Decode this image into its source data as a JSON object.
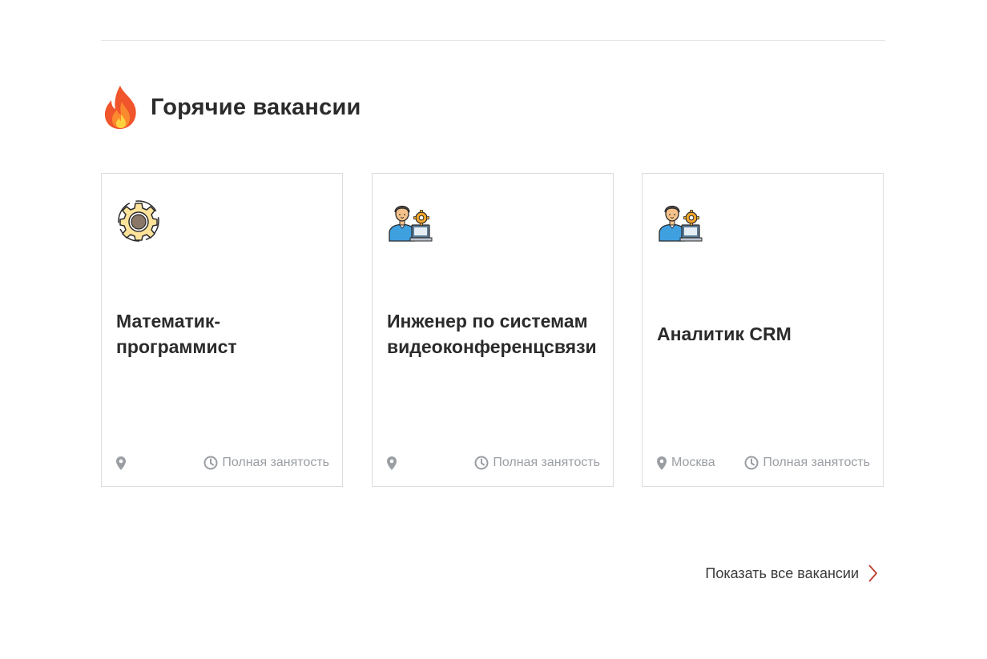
{
  "section": {
    "title": "Горячие вакансии",
    "icon": "fire-icon"
  },
  "vacancies": [
    {
      "title": "Математик-программист",
      "icon": "gear-icon",
      "location": "",
      "employment": "Полная занятость"
    },
    {
      "title": "Инженер по системам видеоконференцсвязи",
      "icon": "engineer-icon",
      "location": "",
      "employment": "Полная занятость"
    },
    {
      "title": "Аналитик CRM",
      "icon": "engineer-icon",
      "location": "Москва",
      "employment": "Полная занятость"
    }
  ],
  "show_all": {
    "label": "Показать все вакансии",
    "icon": "chevron-right-icon"
  },
  "colors": {
    "accent": "#c0392b",
    "muted_text": "#9a9ea3",
    "card_border": "#dcdcdc",
    "title_text": "#2b2b2b"
  }
}
